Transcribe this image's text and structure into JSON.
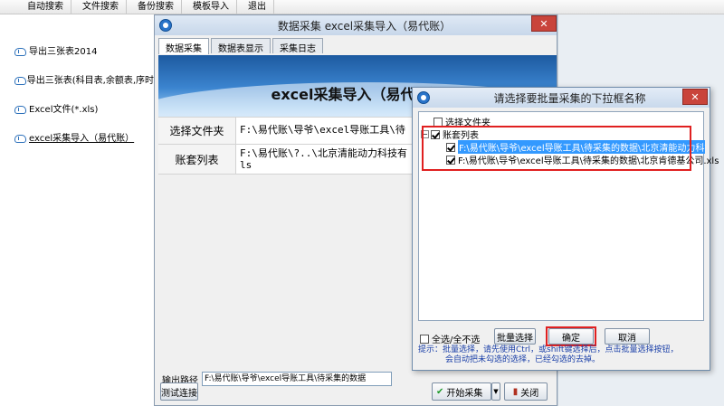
{
  "menubar": {
    "items": [
      "自动搜索",
      "文件搜索",
      "备份搜索",
      "模板导入",
      "退出"
    ]
  },
  "nav": {
    "items": [
      {
        "label": "导出三张表2014"
      },
      {
        "label": "导出三张表(科目表,余额表,序时"
      },
      {
        "label": "Excel文件(*.xls)"
      },
      {
        "label": "excel采集导入（易代账）"
      }
    ]
  },
  "main_window": {
    "title": "数据采集 excel采集导入（易代账）",
    "tabs": [
      "数据采集",
      "数据表显示",
      "采集日志"
    ],
    "banner_title": "excel采集导入（易代账）",
    "select_folder_label": "选择文件夹",
    "select_folder_value": "F:\\易代账\\导爷\\excel导账工具\\待",
    "account_list_label": "账套列表",
    "account_list_value": "F:\\易代账\\?..\\北京清能动力科技有\nls",
    "output_path_label": "输出路径",
    "output_path_value": "F:\\易代账\\导爷\\excel导账工具\\待采集的数据",
    "test_button": "测试连接",
    "start_button": "开始采集",
    "close_button": "关闭"
  },
  "dialog": {
    "title": "请选择要批量采集的下拉框名称",
    "tree": {
      "root": "选择文件夹",
      "group": "账套列表",
      "files": [
        "F:\\易代账\\导爷\\excel导账工具\\待采集的数据\\北京清能动力科技有限",
        "F:\\易代账\\导爷\\excel导账工具\\待采集的数据\\北京肯德基公司.xls"
      ]
    },
    "select_all_label": "全选/全不选",
    "batch_select_button": "批量选择",
    "ok_button": "确定",
    "cancel_button": "取消",
    "tip_line1": "提示：批量选择，请先使用Ctrl，或shift键选择后，点击批量选择按钮，",
    "tip_line2": "会自动把未勾选的选择，已经勾选的去掉。"
  },
  "colors": {
    "highlight_box": "#e02020",
    "selection": "#3399ff",
    "banner": "#3b84cf"
  }
}
